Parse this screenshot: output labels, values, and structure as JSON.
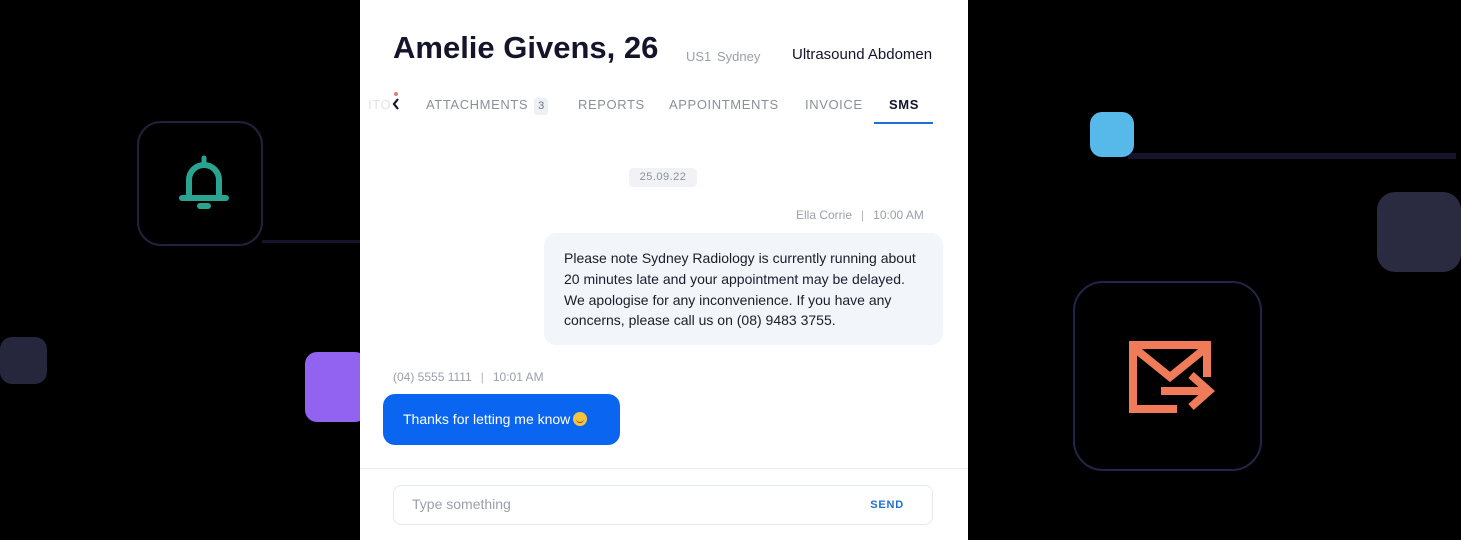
{
  "header": {
    "patient": "Amelie Givens, 26",
    "room_code": "US1",
    "location": "Sydney",
    "exam": "Ultrasound Abdomen"
  },
  "tabs": {
    "clipped_label": "ITO",
    "items": [
      {
        "label": "ATTACHMENTS",
        "badge": "3"
      },
      {
        "label": "REPORTS"
      },
      {
        "label": "APPOINTMENTS"
      },
      {
        "label": "INVOICE"
      },
      {
        "label": "SMS",
        "active": true
      }
    ]
  },
  "conversation": {
    "date": "25.09.22",
    "incoming": {
      "sender": "Ella Corrie",
      "time": "10:00 AM",
      "text": "Please note Sydney Radiology is currently running about 20 minutes late and your appointment may be delayed. We apologise for any inconvenience. If you have any concerns, please call us on (08) 9483 3755."
    },
    "outgoing": {
      "phone": "(04) 5555 1111",
      "time": "10:01 AM",
      "text": "Thanks for letting me know"
    }
  },
  "composer": {
    "placeholder": "Type something",
    "send_label": "SEND"
  },
  "colors": {
    "accent": "#0a66f0",
    "bell": "#2aa491",
    "mail": "#f07b58",
    "purple": "#9163f0",
    "sky": "#57b9ea"
  }
}
